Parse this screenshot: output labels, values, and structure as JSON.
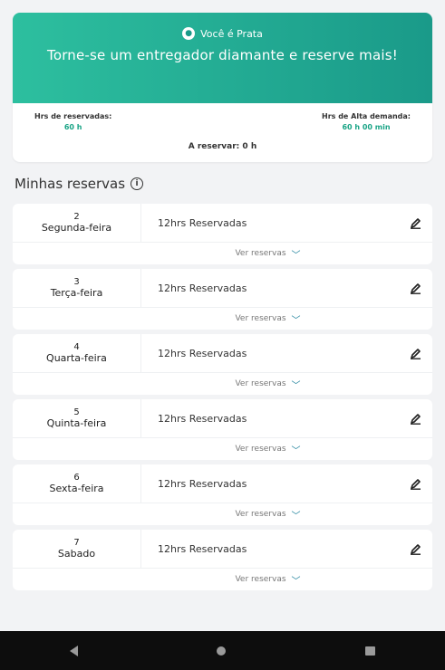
{
  "banner": {
    "level_label": "Você é Prata",
    "headline": "Torne-se um entregador diamante e reserve mais!"
  },
  "stats": {
    "reserved_label": "Hrs de reservadas:",
    "reserved_value": "60 h",
    "peak_label": "Hrs de Alta demanda:",
    "peak_value": "60 h 00 min"
  },
  "to_reserve": "A reservar: 0 h",
  "section_title": "Minhas reservas",
  "expand_label": "Ver reservas",
  "reservations": [
    {
      "num": "2",
      "day": "Segunda-feira",
      "status": "12hrs Reservadas"
    },
    {
      "num": "3",
      "day": "Terça-feira",
      "status": "12hrs Reservadas"
    },
    {
      "num": "4",
      "day": "Quarta-feira",
      "status": "12hrs Reservadas"
    },
    {
      "num": "5",
      "day": "Quinta-feira",
      "status": "12hrs Reservadas"
    },
    {
      "num": "6",
      "day": "Sexta-feira",
      "status": "12hrs Reservadas"
    },
    {
      "num": "7",
      "day": "Sabado",
      "status": "12hrs Reservadas"
    }
  ],
  "colors": {
    "accent": "#1a9a89",
    "accent_light": "#2dbf9f",
    "navbar": "#0d0d0d"
  },
  "icons": {
    "level": "medal-icon",
    "info": "info-icon",
    "edit": "pencil-icon",
    "expand": "chevron-down-icon"
  }
}
